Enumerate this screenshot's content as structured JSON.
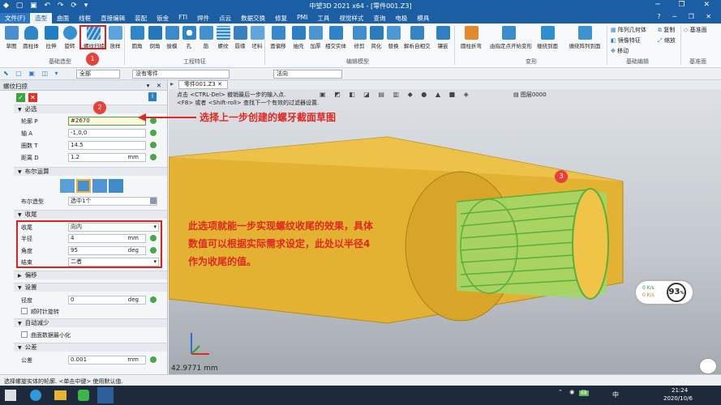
{
  "window": {
    "title": "中望3D 2021 x64 - [零件001.Z3]",
    "quick_access": "◆ ▢ ▣ ↶ ↷ ⟳ ▾",
    "controls": "─ ❐ ✕"
  },
  "menu": {
    "items": [
      "文件(F)",
      "造型",
      "曲面",
      "线框",
      "直接编辑",
      "装配",
      "钣金",
      "FTI",
      "焊件",
      "点云",
      "数据交换",
      "修复",
      "PMI",
      "工具",
      "视觉样式",
      "查询",
      "电极",
      "模具"
    ],
    "right_icons": "? ─ ❐ ✕"
  },
  "ribbon": {
    "basic_shape_buttons": [
      "草图",
      "圆柱体",
      "拉伸",
      "旋转",
      "螺纹扫掠",
      "放样"
    ],
    "eng_feature_buttons": [
      "圆角",
      "倒角",
      "拔模",
      "孔",
      "筋",
      "螺纹",
      "唇缘",
      "坯料"
    ],
    "edit_model_buttons": [
      "面偏移",
      "抽壳",
      "加厚",
      "相交实体",
      "修剪",
      "简化",
      "替换",
      "解析自相交",
      "镶嵌"
    ],
    "deform_buttons": [
      "圆柱折弯",
      "由指定点开始变形",
      "缠绕到面",
      "缠绕阵列到面"
    ],
    "basic_edit_items": [
      "阵列几何体",
      "镜像特征",
      "移动",
      "复制",
      "缩放"
    ],
    "datum_label": "基准面",
    "groups": [
      "基础造型",
      "工程特征",
      "编辑模型",
      "变形",
      "基础编辑",
      "基准面"
    ]
  },
  "filterbar": {
    "filter_value": "全部",
    "part_value": "没有零件",
    "direction_value": "法向"
  },
  "panel": {
    "title": "螺纹扫掠",
    "sections": {
      "required": "必选",
      "boolean": "布尔运算",
      "tail": "收尾",
      "offset": "偏移",
      "settings": "设置",
      "auto_reduce": "自动减少",
      "tolerance": "公差"
    },
    "fields": {
      "profile_label": "轮廓 P",
      "profile_value": "#2670",
      "axis_label": "轴 A",
      "axis_value": "-1,0,0",
      "turns_label": "圈数 T",
      "turns_value": "14.5",
      "distance_label": "距离 D",
      "distance_value": "1.2",
      "distance_unit": "mm",
      "bool_shape_label": "布尔造型",
      "bool_shape_value": "选中1个",
      "tail_label": "收尾",
      "tail_value": "向内",
      "radius_label": "半径",
      "radius_value": "4",
      "radius_unit": "mm",
      "angle_label": "角度",
      "angle_value": "95",
      "angle_unit": "deg",
      "end_label": "结束",
      "end_value": "二者",
      "slope_label": "径度",
      "slope_value": "0",
      "slope_unit": "deg",
      "ccw_label": "顺时针旋转",
      "reduce_label": "曲面数据最小化",
      "tol_label": "公差",
      "tol_value": "0.001",
      "tol_unit": "mm"
    }
  },
  "viewport": {
    "tab_label": "零件001.Z3",
    "hint_line1": "点击 <CTRL-Del> 撤销最后一步的输入点.",
    "hint_line2": "<F8> 或者 <Shift-roll> 查找下一个有效的过滤器设置.",
    "layer_label": "图层0000",
    "annotation_top": "选择上一步创建的螺牙截面草图",
    "annotation_body": "此选项就能一步实现螺纹收尾的效果，具体数值可以根据实际需求设定，此处以半径4作为收尾的值。",
    "measurement": "42.9771 mm",
    "gauge_value": "93",
    "gauge_unit": "%",
    "net_up": "0 K/s",
    "net_down": "0 K/s",
    "marker_1": "1",
    "marker_2": "2",
    "marker_3": "3"
  },
  "status": {
    "text": "选择螺旋实体的轮廓. <单击中键> 使用默认值."
  },
  "taskbar": {
    "time": "21:24",
    "date": "2020/10/6",
    "battery": "68",
    "ime": "中"
  },
  "colors": {
    "title_bg": "#1b5ea3",
    "part_yellow": "#e3b232",
    "thread_green": "#7fd35a",
    "annotation_red": "#e0281f"
  }
}
